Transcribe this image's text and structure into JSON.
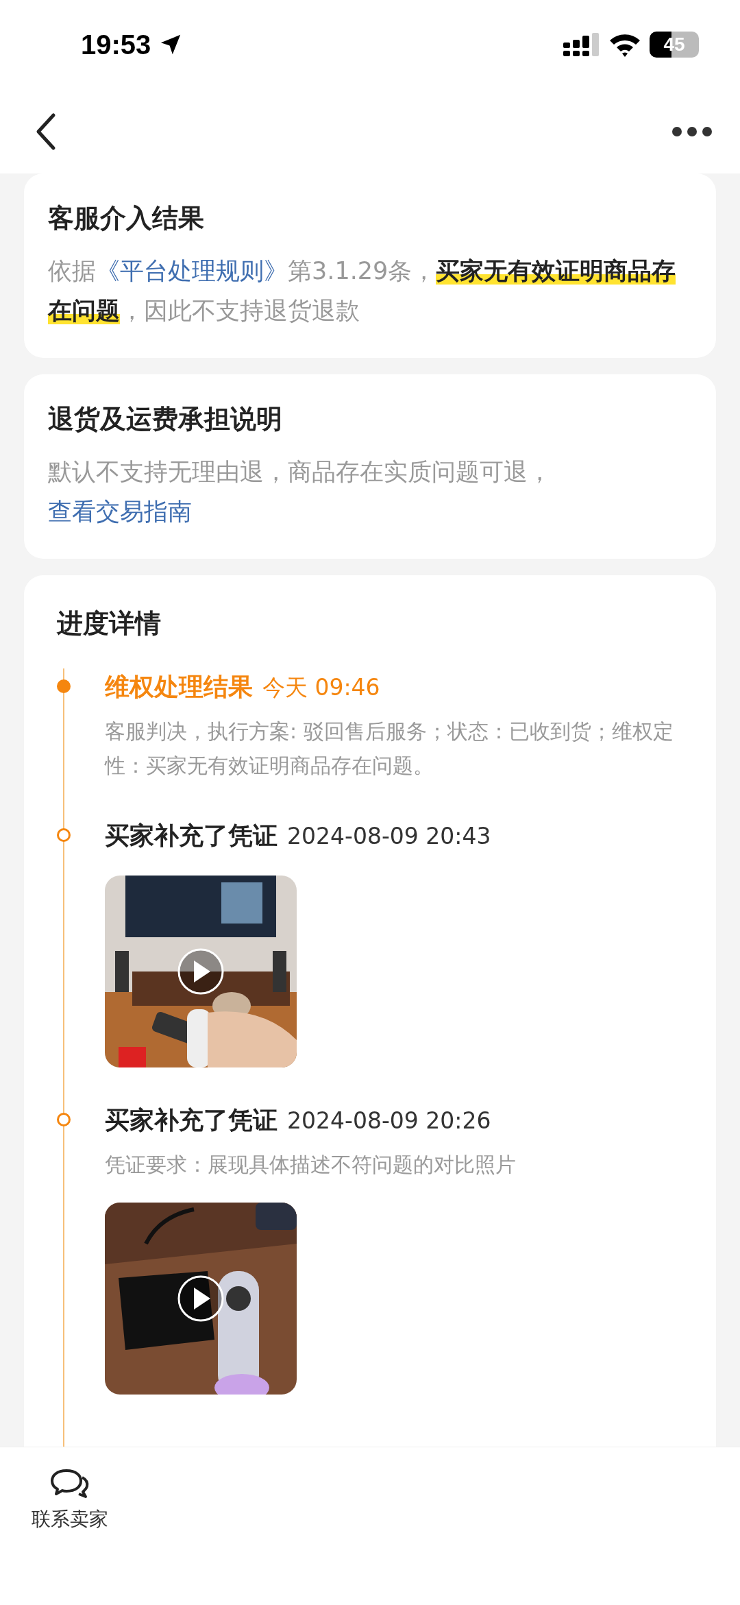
{
  "status_bar": {
    "time": "19:53",
    "battery": "45"
  },
  "verdict_card": {
    "title": "客服介入结果",
    "prefix": "依据",
    "link": "《平台处理规则》",
    "text": "第3.1.29条，**买家无有效证明商品存在问题**，因此不支持退货退款"
  },
  "policy_card": {
    "title": "退货及运费承担说明",
    "text": "默认不支持无理由退，商品存在实质问题可退，",
    "link": "查看交易指南"
  },
  "progress": {
    "title": "进度详情",
    "events": [
      {
        "kind": "result",
        "title": "维权处理结果",
        "time": "今天 09:46",
        "note": "客服判决，执行方案: 驳回售后服务；状态：已收到货；维权定性：买家无有效证明商品存在问题。"
      },
      {
        "kind": "evidence",
        "title": "买家补充了凭证",
        "time": "2024-08-09 20:43"
      },
      {
        "kind": "evidence",
        "title": "买家补充了凭证",
        "time": "2024-08-09 20:26",
        "note": "凭证要求：展现具体描述不符问题的对比照片"
      }
    ]
  },
  "bottom_bar": {
    "contact": "联系卖家"
  }
}
